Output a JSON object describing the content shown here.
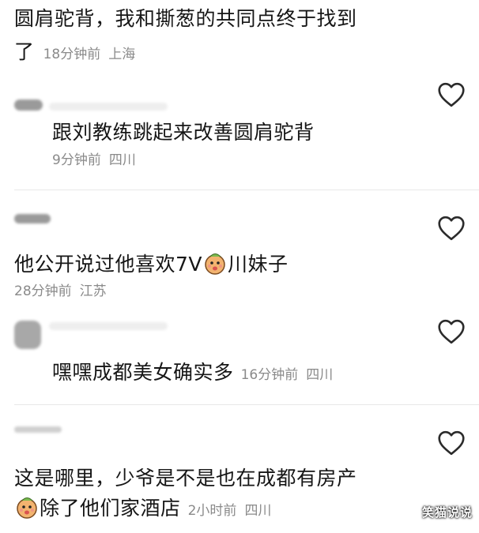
{
  "comments": [
    {
      "line1": "圆肩驼背，我和撕葱的共同点终于找到",
      "line2": "了",
      "time": "18分钟前",
      "location": "上海"
    },
    {
      "text": "跟刘教练跳起来改善圆肩驼背",
      "time": "9分钟前",
      "location": "四川"
    },
    {
      "text_before": "他公开说过他喜欢7V",
      "emoji": "peach-face-emoji",
      "text_after": "川妹子",
      "time": "28分钟前",
      "location": "江苏"
    },
    {
      "text": "嘿嘿成都美女确实多",
      "time": "16分钟前",
      "location": "四川"
    },
    {
      "line1": "这是哪里，少爷是不是也在成都有房产",
      "emoji": "peach-face-emoji",
      "line2": "除了他们家酒店",
      "time": "2小时前",
      "location": "四川"
    }
  ],
  "icons": {
    "like": "heart-outline-icon"
  },
  "colors": {
    "text": "#161616",
    "meta": "#8a8a8a",
    "divider": "#e8e8e8",
    "heart": "#2b2b2b",
    "emoji": "#f2b36f"
  },
  "watermark": "笑猫说说"
}
